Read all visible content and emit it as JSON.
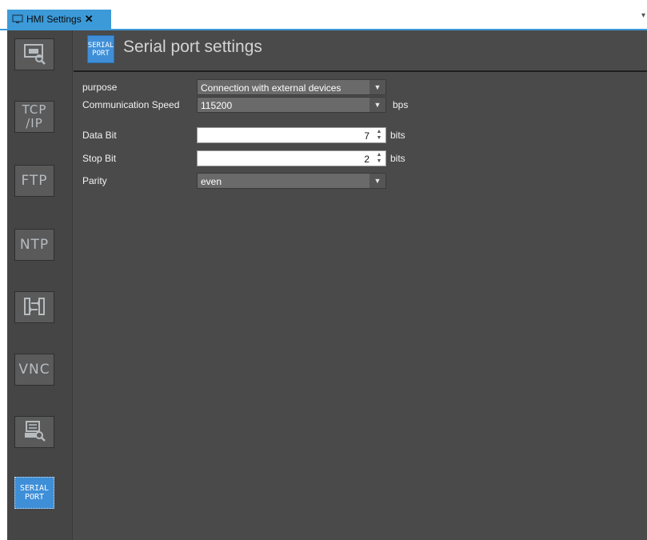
{
  "tab": {
    "title": "HMI Settings",
    "close": "✕",
    "menu": "▾"
  },
  "sidebar": {
    "items": [
      {
        "name": "screen-settings",
        "text": ""
      },
      {
        "name": "tcpip",
        "line1": "TCP",
        "line2": "/IP"
      },
      {
        "name": "ftp",
        "text": "FTP"
      },
      {
        "name": "ntp",
        "text": "NTP"
      },
      {
        "name": "transfer",
        "text": ""
      },
      {
        "name": "vnc",
        "text": "VNC"
      },
      {
        "name": "maintenance",
        "text": ""
      },
      {
        "name": "serial-port",
        "line1": "SERIAL",
        "line2": "PORT"
      }
    ],
    "active_index": 7
  },
  "header": {
    "icon_line1": "SERIAL",
    "icon_line2": "PORT",
    "title": "Serial port settings"
  },
  "form": {
    "purpose": {
      "label": "purpose",
      "value": "Connection with external devices"
    },
    "speed": {
      "label": "Communication Speed",
      "value": "115200",
      "unit": "bps"
    },
    "data_bit": {
      "label": "Data Bit",
      "value": "7",
      "unit": "bits"
    },
    "stop_bit": {
      "label": "Stop Bit",
      "value": "2",
      "unit": "bits"
    },
    "parity": {
      "label": "Parity",
      "value": "even"
    }
  },
  "colors": {
    "accent": "#3c9ad8",
    "panel": "#4a4a4a",
    "sidebar": "#454545"
  }
}
